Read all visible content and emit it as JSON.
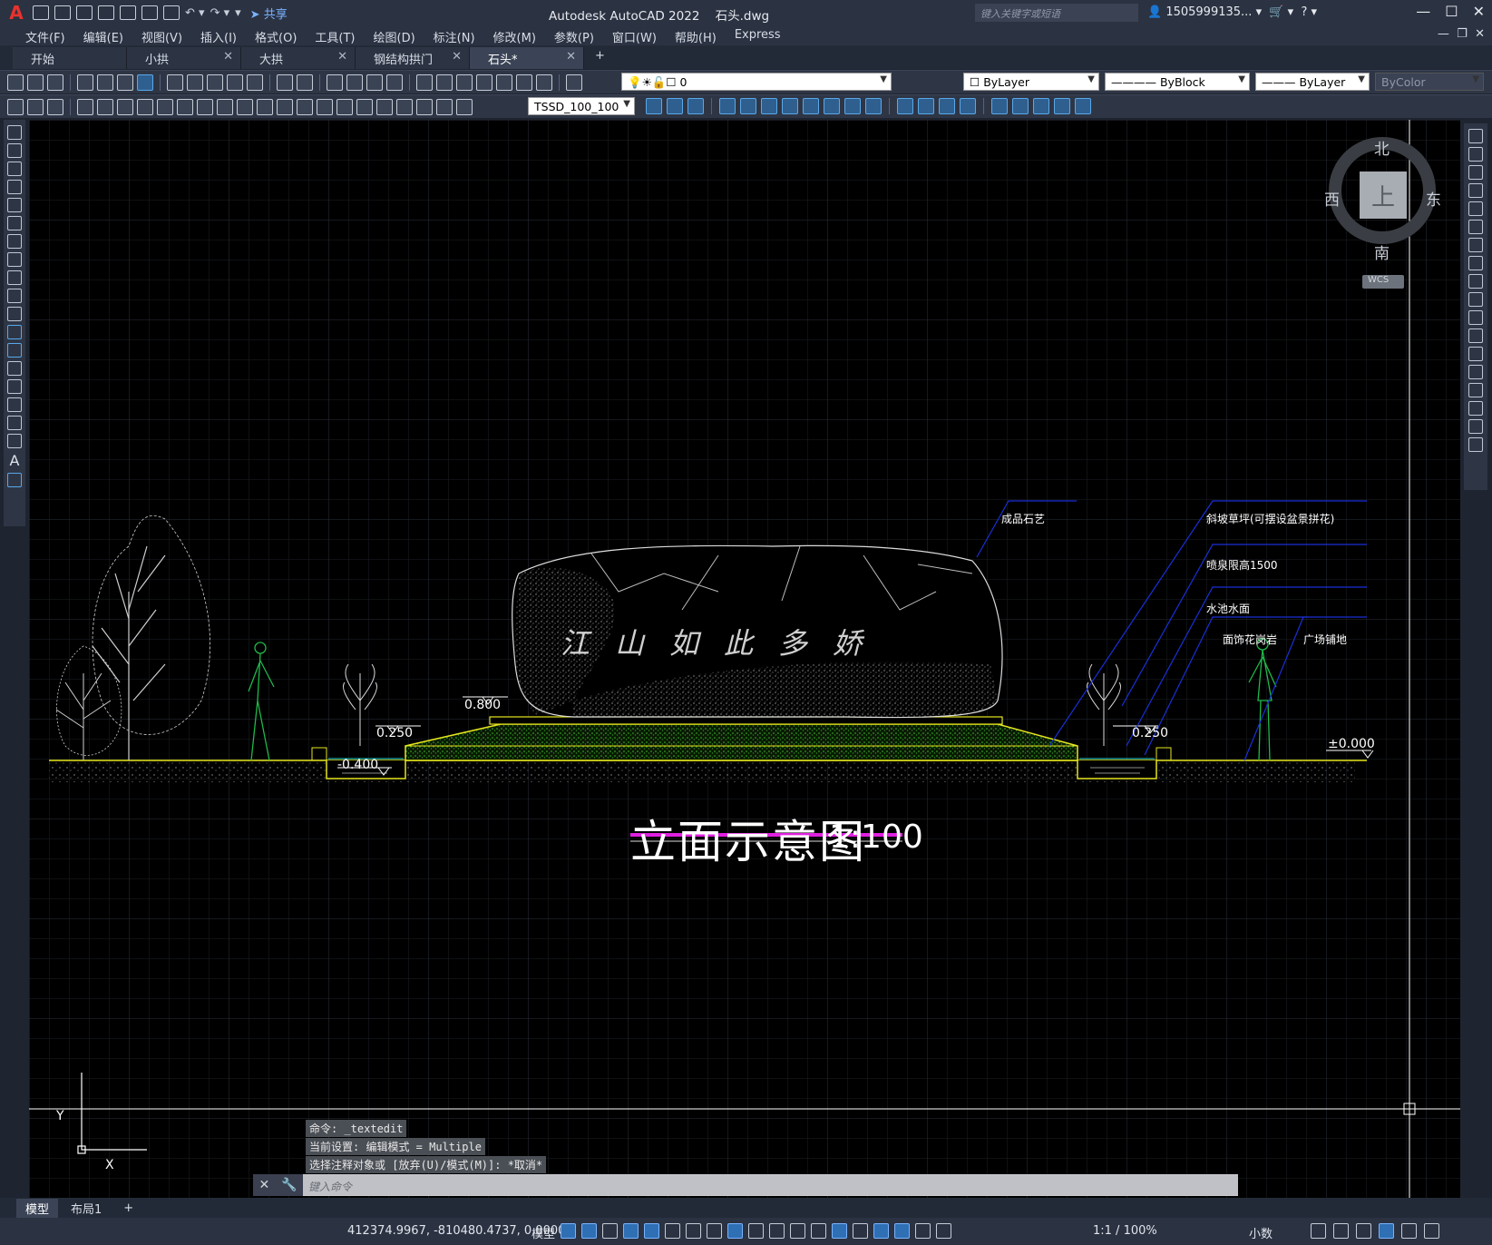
{
  "app": {
    "logo": "A",
    "title": "Autodesk AutoCAD 2022",
    "file": "石头.dwg",
    "share": "共享",
    "search_placeholder": "键入关键字或短语",
    "user": "1505999135...",
    "window_controls": [
      "—",
      "☐",
      "✕"
    ]
  },
  "menu": [
    "文件(F)",
    "编辑(E)",
    "视图(V)",
    "插入(I)",
    "格式(O)",
    "工具(T)",
    "绘图(D)",
    "标注(N)",
    "修改(M)",
    "参数(P)",
    "窗口(W)",
    "帮助(H)",
    "Express"
  ],
  "file_tabs": [
    {
      "label": "开始",
      "closable": false,
      "active": false
    },
    {
      "label": "小拱",
      "closable": true,
      "active": false
    },
    {
      "label": "大拱",
      "closable": true,
      "active": false
    },
    {
      "label": "钢结构拱门",
      "closable": true,
      "active": false
    },
    {
      "label": "石头*",
      "closable": true,
      "active": true
    }
  ],
  "toolbar": {
    "layer": "0",
    "color": "ByLayer",
    "linetype": "ByBlock",
    "lineweight": "ByLayer",
    "plotstyle": "ByColor",
    "dimstyle": "TSSD_100_100"
  },
  "viewcube": {
    "north": "北",
    "south": "南",
    "east": "东",
    "west": "西",
    "top": "上",
    "wcs": "WCS"
  },
  "drawing": {
    "title": "立面示意图",
    "scale": "1:100",
    "stone_inscription": "江山如此多娇",
    "callouts": {
      "stone": "成品石艺",
      "slope": "斜坡草坪(可摆设盆景拼花)",
      "fountain": "喷泉限高1500",
      "pool": "水池水面",
      "granite": "面饰花岗岩",
      "plaza": "广场铺地"
    },
    "elevations": {
      "top": "0.800",
      "left_pool": "0.250",
      "right_pool": "0.250",
      "pool_bottom": "-0.400",
      "ground": "±0.000"
    },
    "ucs": {
      "y": "Y",
      "x": "X"
    }
  },
  "command": {
    "history": [
      "命令: _textedit",
      "当前设置: 编辑模式 = Multiple",
      "选择注释对象或 [放弃(U)/模式(M)]: *取消*"
    ],
    "placeholder": "键入命令"
  },
  "layout_tabs": [
    {
      "label": "模型",
      "active": true
    },
    {
      "label": "布局1",
      "active": false
    }
  ],
  "status": {
    "coords": "412374.9967, -810480.4737, 0.0000",
    "space": "模型",
    "annotation_scale": "1:1 / 100%",
    "units": "小数"
  },
  "colors": {
    "canvas": "#000000",
    "ground_line": "#e6e61e",
    "leader": "#1a2fd6",
    "figures": "#1fb84a",
    "title_underline": "#e020e0"
  }
}
